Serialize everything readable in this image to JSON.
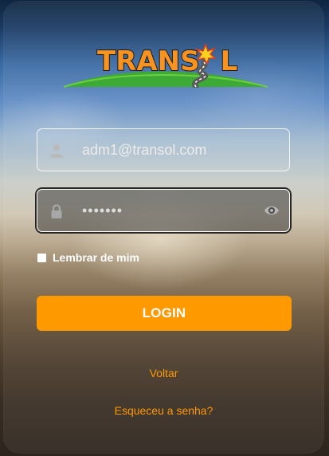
{
  "brand": {
    "logo_text": "TRANSOL",
    "logo_text_left": "TRANS",
    "logo_text_right": "L"
  },
  "form": {
    "email_value": "adm1@transol.com",
    "password_value": "•••••••",
    "remember_label": "Lembrar de mim",
    "login_label": "LOGIN"
  },
  "links": {
    "back_label": "Voltar",
    "forgot_label": "Esqueceu a senha?"
  },
  "icons": {
    "email": "user-icon",
    "password": "lock-icon",
    "toggle": "eye-icon"
  },
  "colors": {
    "accent": "#ff9900",
    "logo_orange": "#f7931e",
    "hill_green": "#3daa35"
  }
}
